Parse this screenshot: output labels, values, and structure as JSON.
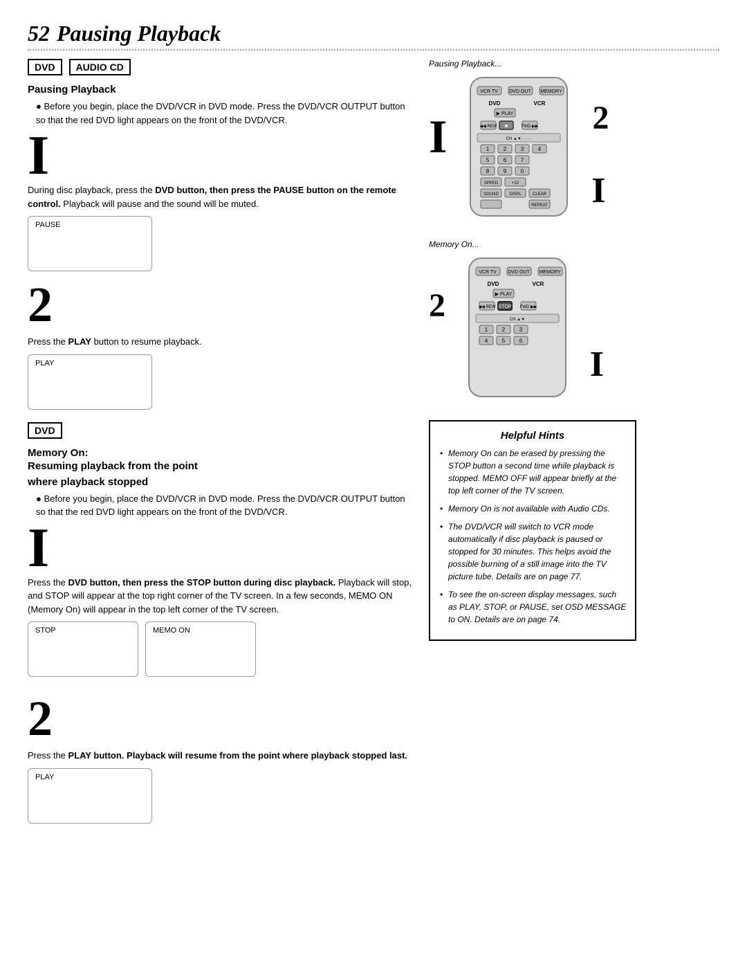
{
  "page": {
    "number": "52",
    "title": "Pausing Playback",
    "dotted_line": true
  },
  "badges": [
    "DVD",
    "AUDIO CD"
  ],
  "section1": {
    "title": "Pausing Playback",
    "bullet": "Before you begin, place the DVD/VCR in DVD mode. Press the DVD/VCR OUTPUT button so that the red DVD light appears on the front of the DVD/VCR.",
    "step1_bar": "I",
    "step1_instruction": "During disc playback, press the DVD button, then press the PAUSE button on the remote control. Playback will pause and the sound will be muted.",
    "screen1_label": "PAUSE",
    "step2_num": "2",
    "step2_instruction": "Press the PLAY button to resume playback.",
    "screen2_label": "PLAY"
  },
  "right_caption1": "Pausing Playback...",
  "right_caption2": "Memory On...",
  "section2_badge": "DVD",
  "section2": {
    "title": "Memory On:",
    "subtitle1": "Resuming playback from the point",
    "subtitle2": "where playback stopped",
    "bullet": "Before you begin, place the DVD/VCR in DVD mode. Press the DVD/VCR OUTPUT button so that the red DVD light appears on the front of the DVD/VCR.",
    "step1_bar": "I",
    "step1_instruction_part1": "Press the DVD button, then press the ",
    "step1_bold": "STOP",
    "step1_instruction_part2": " button during disc playback.",
    "step1_instruction_rest": " Playback will stop, and STOP will appear at the top right corner of the TV screen. In a few seconds, MEMO ON (Memory On) will appear in the top left corner of the TV screen.",
    "screen_stop_label": "STOP",
    "screen_memo_label": "MEMO ON",
    "step2_num": "2",
    "step2_instruction": "Press the PLAY button. Playback will resume from the point where playback stopped last.",
    "screen3_label": "PLAY"
  },
  "helpful_hints": {
    "title": "Helpful Hints",
    "hints": [
      "Memory On can be erased by pressing the STOP button a second time while playback is stopped. MEMO OFF will appear briefly at the top left corner of the TV screen.",
      "Memory On is not available with Audio CDs.",
      "The DVD/VCR will switch to VCR mode automatically if disc playback is paused or stopped for 30 minutes. This helps avoid the possible burning of a still image into the TV picture tube. Details are on page 77.",
      "To see the on-screen display messages, such as PLAY, STOP, or PAUSE, set OSD MESSAGE to ON. Details are on page 74."
    ]
  }
}
